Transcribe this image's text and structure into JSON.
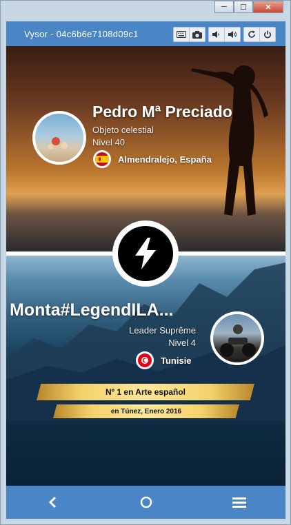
{
  "window": {
    "title": "Vysor - 04c6b6e7108d09c1",
    "minimize": "─",
    "maximize": "☐",
    "close": "✕"
  },
  "toolbar": {
    "icons": [
      "keyboard-icon",
      "camera-icon",
      "volume-down-icon",
      "volume-up-icon",
      "rotate-icon",
      "power-icon"
    ]
  },
  "player1": {
    "name": "Pedro Mª Preciado",
    "title": "Objeto celestial",
    "level": "Nivel 40",
    "country": "Almendralejo, España",
    "flag": "spain"
  },
  "player2": {
    "name": "Monta#LegendILA...",
    "title": "Leader Suprême",
    "level": "Nivel 4",
    "country": "Tunisie",
    "flag": "tunisia"
  },
  "ranking": {
    "headline": "Nº 1 en Arte español",
    "detail": "en Túnez, Enero 2016"
  },
  "colors": {
    "vysor_blue": "#4a86c6",
    "ribbon_gold": "#f3d26a"
  }
}
